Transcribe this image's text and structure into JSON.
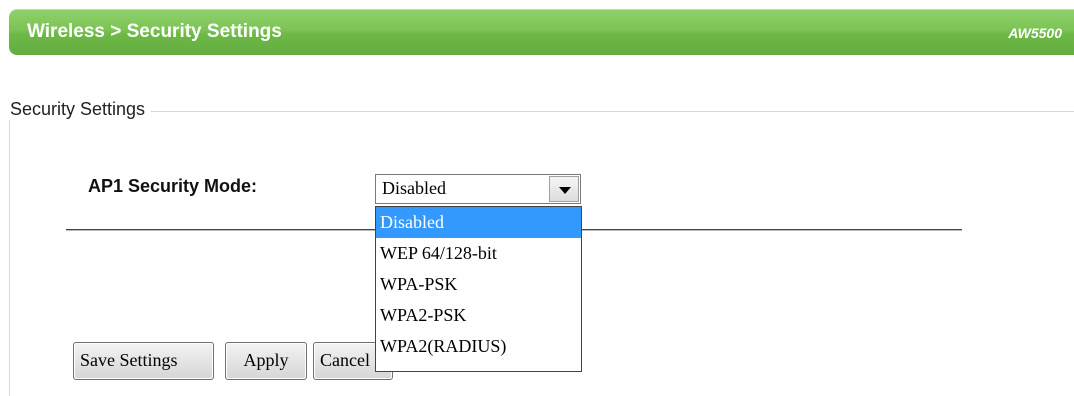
{
  "header": {
    "breadcrumb": "Wireless > Security Settings",
    "model": "AW5500",
    "accent_color": "#6db847"
  },
  "section": {
    "legend": "Security Settings"
  },
  "security_mode": {
    "label": "AP1 Security Mode:",
    "selected_value": "Disabled",
    "options": [
      {
        "label": "Disabled",
        "highlighted": true
      },
      {
        "label": "WEP 64/128-bit",
        "highlighted": false
      },
      {
        "label": "WPA-PSK",
        "highlighted": false
      },
      {
        "label": "WPA2-PSK",
        "highlighted": false
      },
      {
        "label": "WPA2(RADIUS)",
        "highlighted": false
      }
    ],
    "highlight_color": "#3399ff"
  },
  "buttons": {
    "save_label": "Save Settings",
    "apply_label": "Apply",
    "cancel_label": "Cancel"
  }
}
